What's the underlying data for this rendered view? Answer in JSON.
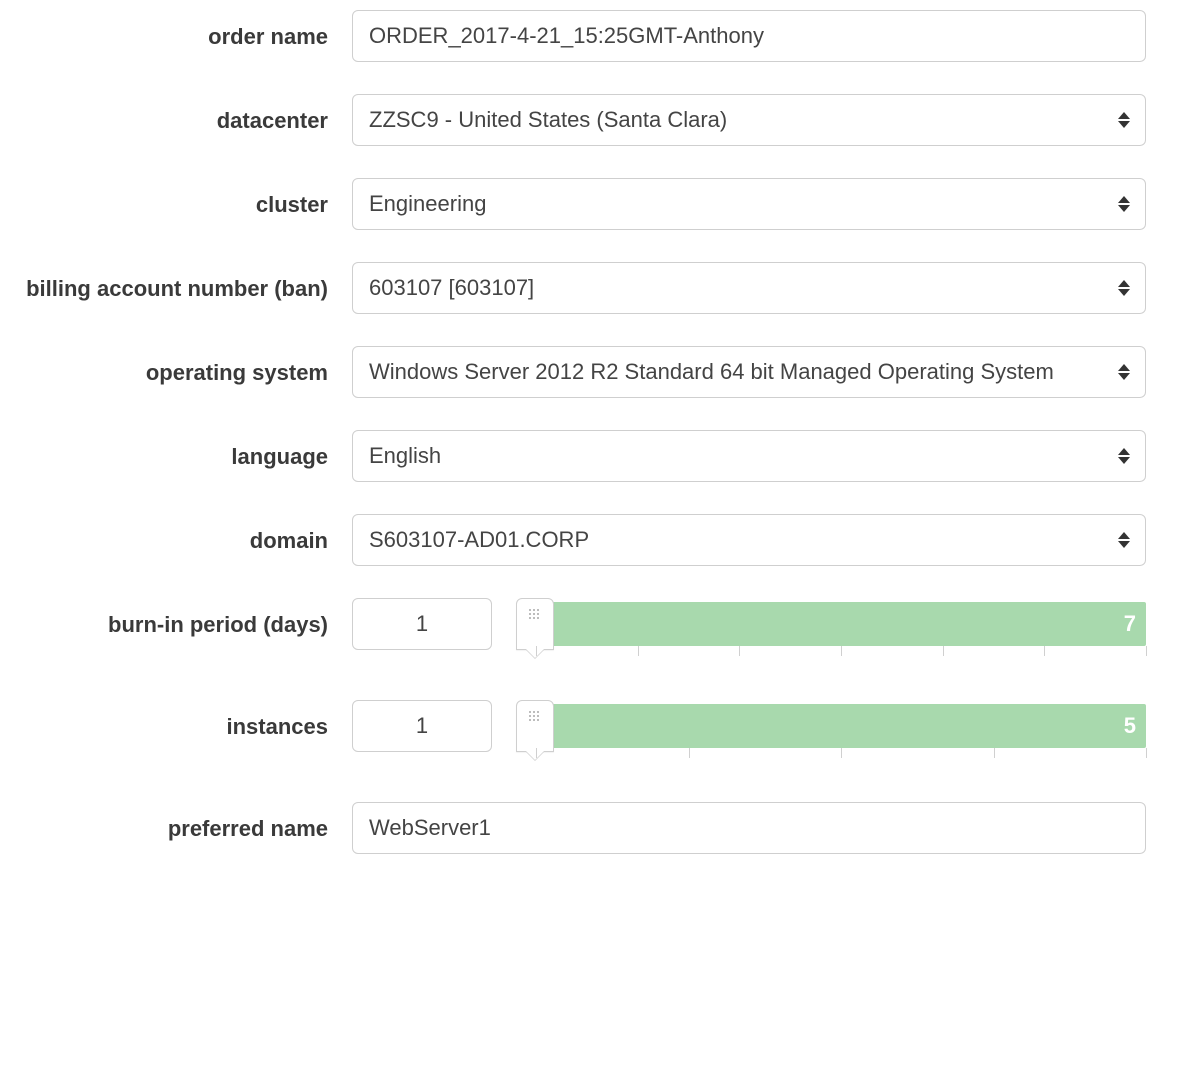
{
  "fields": {
    "order_name": {
      "label": "order name",
      "value": "ORDER_2017-4-21_15:25GMT-Anthony"
    },
    "datacenter": {
      "label": "datacenter",
      "value": "ZZSC9 - United States (Santa Clara)"
    },
    "cluster": {
      "label": "cluster",
      "value": "Engineering"
    },
    "ban": {
      "label": "billing account number (ban)",
      "value": "603107 [603107]"
    },
    "os": {
      "label": "operating system",
      "value": "Windows Server 2012 R2 Standard 64 bit Managed Operating System"
    },
    "language": {
      "label": "language",
      "value": "English"
    },
    "domain": {
      "label": "domain",
      "value": "S603107-AD01.CORP"
    },
    "burn_in": {
      "label": "burn-in period (days)",
      "value": "1",
      "max": "7"
    },
    "instances": {
      "label": "instances",
      "value": "1",
      "max": "5"
    },
    "preferred_name": {
      "label": "preferred name",
      "value": "WebServer1"
    }
  },
  "colors": {
    "accent": "#a8d9ad"
  }
}
